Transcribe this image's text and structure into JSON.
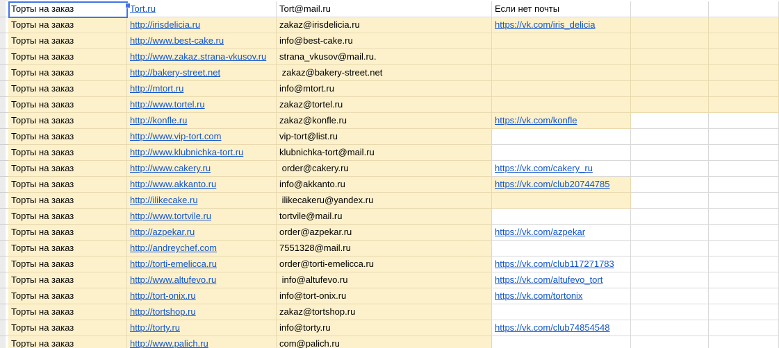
{
  "palette": {
    "highlight_fill": "#fdf1cc",
    "link_color": "#1155cc",
    "selection_color": "#4274e8",
    "grid_cream": "#e8d9ae",
    "grid_white": "#d9d9d9",
    "row_header_bg": "#ececec"
  },
  "selection": {
    "cell": "A1"
  },
  "rows": [
    {
      "category": "Торты на заказ",
      "url": "Tort.ru",
      "email": "Tort@mail.ru",
      "vk": "Если нет почты",
      "vk_is_link": false,
      "header_row": true,
      "highlight_abc": false,
      "highlight_d": false,
      "highlight_ef": false
    },
    {
      "category": "Торты на заказ",
      "url": "http://irisdelicia.ru",
      "email": "zakaz@irisdelicia.ru",
      "vk": "https://vk.com/iris_delicia",
      "vk_is_link": true,
      "header_row": false,
      "highlight_abc": true,
      "highlight_d": true,
      "highlight_ef": true
    },
    {
      "category": "Торты на заказ",
      "url": "http://www.best-cake.ru",
      "email": "info@best-cake.ru",
      "vk": "",
      "vk_is_link": false,
      "header_row": false,
      "highlight_abc": true,
      "highlight_d": true,
      "highlight_ef": true
    },
    {
      "category": "Торты на заказ",
      "url": "http://www.zakaz.strana-vkusov.ru",
      "email": "strana_vkusov@mail.ru.",
      "vk": "",
      "vk_is_link": false,
      "header_row": false,
      "highlight_abc": true,
      "highlight_d": true,
      "highlight_ef": true
    },
    {
      "category": "Торты на заказ",
      "url": "http://bakery-street.net",
      "email": " zakaz@bakery-street.net",
      "vk": "",
      "vk_is_link": false,
      "header_row": false,
      "highlight_abc": true,
      "highlight_d": true,
      "highlight_ef": true
    },
    {
      "category": "Торты на заказ",
      "url": "http://mtort.ru",
      "email": "info@mtort.ru",
      "vk": "",
      "vk_is_link": false,
      "header_row": false,
      "highlight_abc": true,
      "highlight_d": true,
      "highlight_ef": true
    },
    {
      "category": "Торты на заказ",
      "url": "http://www.tortel.ru",
      "email": "zakaz@tortel.ru",
      "vk": "",
      "vk_is_link": false,
      "header_row": false,
      "highlight_abc": true,
      "highlight_d": true,
      "highlight_ef": true
    },
    {
      "category": "Торты на заказ",
      "url": "http://konfle.ru",
      "email": "zakaz@konfle.ru",
      "vk": "https://vk.com/konfle",
      "vk_is_link": true,
      "header_row": false,
      "highlight_abc": true,
      "highlight_d": true,
      "highlight_ef": false
    },
    {
      "category": "Торты на заказ",
      "url": "http://www.vip-tort.com",
      "email": "vip-tort@list.ru",
      "vk": "",
      "vk_is_link": false,
      "header_row": false,
      "highlight_abc": true,
      "highlight_d": false,
      "highlight_ef": false
    },
    {
      "category": "Торты на заказ",
      "url": "http://www.klubnichka-tort.ru",
      "email": "klubnichka-tort@mail.ru",
      "vk": "",
      "vk_is_link": false,
      "header_row": false,
      "highlight_abc": true,
      "highlight_d": false,
      "highlight_ef": false
    },
    {
      "category": "Торты на заказ",
      "url": "http://www.cakery.ru",
      "email": " order@cakery.ru",
      "vk": "https://vk.com/cakery_ru",
      "vk_is_link": true,
      "header_row": false,
      "highlight_abc": true,
      "highlight_d": false,
      "highlight_ef": false
    },
    {
      "category": "Торты на заказ",
      "url": "http://www.akkanto.ru",
      "email": "info@akkanto.ru",
      "vk": "https://vk.com/club20744785",
      "vk_is_link": true,
      "header_row": false,
      "highlight_abc": true,
      "highlight_d": true,
      "highlight_ef": false
    },
    {
      "category": "Торты на заказ",
      "url": "http://ilikecake.ru",
      "email": " ilikecakeru@yandex.ru",
      "vk": "",
      "vk_is_link": false,
      "header_row": false,
      "highlight_abc": true,
      "highlight_d": true,
      "highlight_ef": false
    },
    {
      "category": "Торты на заказ",
      "url": "http://www.tortvile.ru",
      "email": "tortvile@mail.ru",
      "vk": "",
      "vk_is_link": false,
      "header_row": false,
      "highlight_abc": true,
      "highlight_d": false,
      "highlight_ef": false
    },
    {
      "category": "Торты на заказ",
      "url": "http://azpekar.ru",
      "email": "order@azpekar.ru",
      "vk": "https://vk.com/azpekar",
      "vk_is_link": true,
      "header_row": false,
      "highlight_abc": true,
      "highlight_d": false,
      "highlight_ef": false
    },
    {
      "category": "Торты на заказ",
      "url": "http://andreychef.com",
      "email": "7551328@mail.ru",
      "vk": "",
      "vk_is_link": false,
      "header_row": false,
      "highlight_abc": true,
      "highlight_d": false,
      "highlight_ef": false
    },
    {
      "category": "Торты на заказ",
      "url": "http://torti-emelicca.ru",
      "email": "order@torti-emelicca.ru",
      "vk": "https://vk.com/club117271783",
      "vk_is_link": true,
      "header_row": false,
      "highlight_abc": true,
      "highlight_d": false,
      "highlight_ef": false
    },
    {
      "category": "Торты на заказ",
      "url": "http://www.altufevo.ru",
      "email": " info@altufevo.ru",
      "vk": "https://vk.com/altufevo_tort",
      "vk_is_link": true,
      "header_row": false,
      "highlight_abc": true,
      "highlight_d": false,
      "highlight_ef": false
    },
    {
      "category": "Торты на заказ",
      "url": "http://tort-onix.ru",
      "email": "info@tort-onix.ru",
      "vk": "https://vk.com/tortonix",
      "vk_is_link": true,
      "header_row": false,
      "highlight_abc": true,
      "highlight_d": false,
      "highlight_ef": false
    },
    {
      "category": "Торты на заказ",
      "url": "http://tortshop.ru",
      "email": "zakaz@tortshop.ru",
      "vk": "",
      "vk_is_link": false,
      "header_row": false,
      "highlight_abc": true,
      "highlight_d": false,
      "highlight_ef": false
    },
    {
      "category": "Торты на заказ",
      "url": "http://torty.ru",
      "email": "info@torty.ru",
      "vk": "https://vk.com/club74854548",
      "vk_is_link": true,
      "header_row": false,
      "highlight_abc": true,
      "highlight_d": false,
      "highlight_ef": false
    },
    {
      "category": "Торты на заказ",
      "url": "http://www.palich.ru",
      "email": "com@palich.ru",
      "vk": "",
      "vk_is_link": false,
      "header_row": false,
      "highlight_abc": true,
      "highlight_d": false,
      "highlight_ef": false
    }
  ]
}
